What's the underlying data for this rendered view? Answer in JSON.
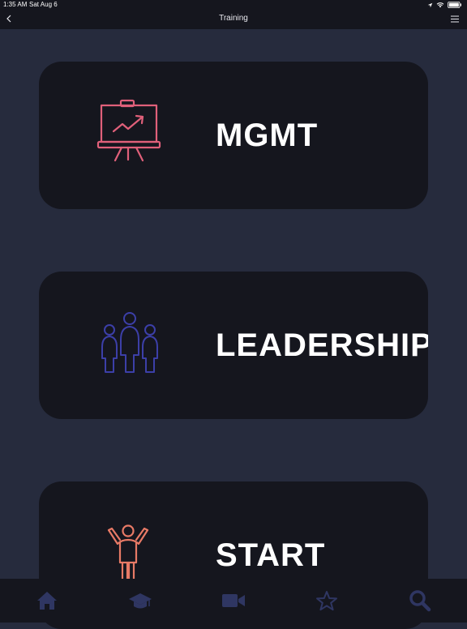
{
  "status": {
    "time": "1:35 AM",
    "date": "Sat Aug 6"
  },
  "nav": {
    "title": "Training"
  },
  "cards": [
    {
      "label": "MGMT",
      "icon": "presentation-board-chart-icon",
      "color": "#e0607a"
    },
    {
      "label": "LEADERSHIP",
      "icon": "group-people-icon",
      "color": "#3c3fa8"
    },
    {
      "label": "START",
      "icon": "person-arms-raised-icon",
      "color": "#e87a66"
    }
  ],
  "tab_bar": {
    "tabs": [
      "home-icon",
      "graduation-cap-icon",
      "video-camera-icon",
      "star-icon",
      "search-icon"
    ],
    "icon_color": "#2f3662"
  },
  "colors": {
    "background": "#262b3d",
    "card": "#15161e",
    "text": "#ffffff"
  }
}
